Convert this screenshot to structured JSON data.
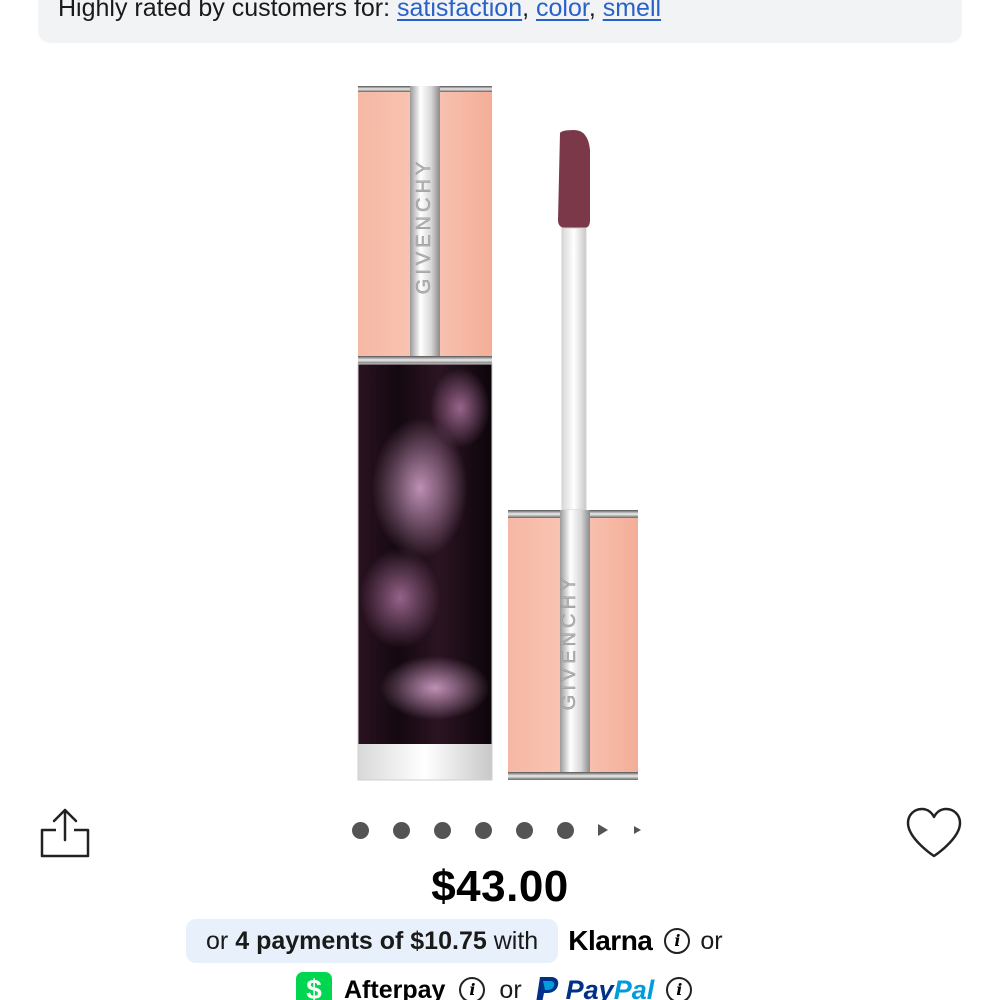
{
  "rated_banner": {
    "prefix": "Highly rated by customers for:",
    "tags": [
      "satisfaction",
      "color",
      "smell"
    ]
  },
  "product_image": {
    "brand_engraving": "GIVENCHY",
    "alt": "Givenchy lip product"
  },
  "carousel": {
    "dots": 6,
    "icons": [
      "arrow-right-icon",
      "arrow-right-small-icon"
    ]
  },
  "price": "$43.00",
  "installments": {
    "or1": "or",
    "count": "4 payments of $10.75",
    "with": "with",
    "klarna": "Klarna",
    "or2": "or",
    "afterpay": "Afterpay",
    "afterpay_badge": "$",
    "or3": "or",
    "paypal_pay": "Pay",
    "paypal_pal": "Pal"
  },
  "colors": {
    "link": "#2862c9",
    "banner_bg": "#f2f3f5",
    "klarna_pill_bg": "#e8f1fb",
    "afterpay_green": "#00d64f",
    "paypal_dark": "#003087",
    "paypal_light": "#009cde"
  },
  "icons": [
    "share-icon",
    "heart-icon",
    "info-icon",
    "paypal-p-icon"
  ]
}
